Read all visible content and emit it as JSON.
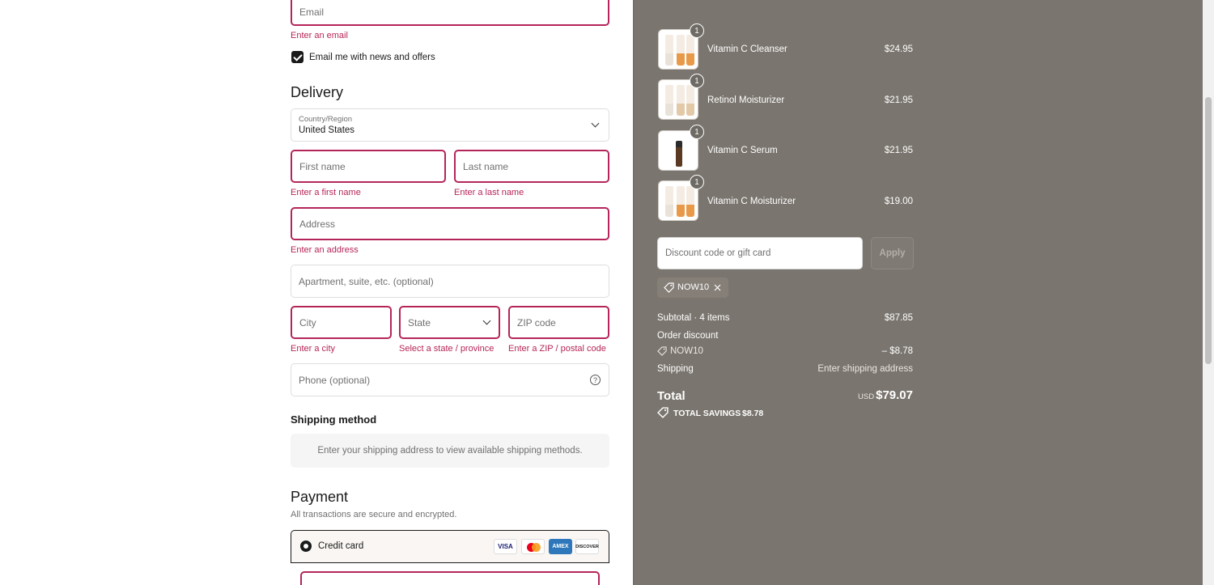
{
  "contact": {
    "email_placeholder": "Email",
    "email_error": "Enter an email",
    "newsletter_label": "Email me with news and offers",
    "newsletter_checked": true
  },
  "delivery": {
    "heading": "Delivery",
    "country_label": "Country/Region",
    "country_value": "United States",
    "first_name_placeholder": "First name",
    "first_name_error": "Enter a first name",
    "last_name_placeholder": "Last name",
    "last_name_error": "Enter a last name",
    "address_placeholder": "Address",
    "address_error": "Enter an address",
    "apartment_placeholder": "Apartment, suite, etc. (optional)",
    "city_placeholder": "City",
    "city_error": "Enter a city",
    "state_placeholder": "State",
    "state_error": "Select a state / province",
    "zip_placeholder": "ZIP code",
    "zip_error": "Enter a ZIP / postal code",
    "phone_placeholder": "Phone (optional)"
  },
  "shipping_method": {
    "heading": "Shipping method",
    "notice": "Enter your shipping address to view available shipping methods."
  },
  "payment": {
    "heading": "Payment",
    "subtitle": "All transactions are secure and encrypted.",
    "credit_card_label": "Credit card",
    "card_brands": [
      "VISA",
      "MC",
      "AMEX",
      "DISCOVER"
    ]
  },
  "order_items": [
    {
      "name": "Vitamin C Cleanser",
      "price": "$24.95",
      "qty": "1"
    },
    {
      "name": "Retinol Moisturizer",
      "price": "$21.95",
      "qty": "1"
    },
    {
      "name": "Vitamin C Serum",
      "price": "$21.95",
      "qty": "1"
    },
    {
      "name": "Vitamin C Moisturizer",
      "price": "$19.00",
      "qty": "1"
    }
  ],
  "discount": {
    "placeholder": "Discount code or gift card",
    "apply_label": "Apply",
    "applied_code": "NOW10"
  },
  "summary": {
    "subtotal_label": "Subtotal · 4 items",
    "subtotal_value": "$87.85",
    "order_discount_label": "Order discount",
    "discount_code": "NOW10",
    "discount_value": "– $8.78",
    "shipping_label": "Shipping",
    "shipping_value": "Enter shipping address",
    "total_label": "Total",
    "currency": "USD",
    "total_value": "$79.07",
    "savings_label": "TOTAL SAVINGS",
    "savings_value": "$8.78"
  },
  "colors": {
    "error": "#b6255a",
    "summary_bg": "#7a756e"
  }
}
